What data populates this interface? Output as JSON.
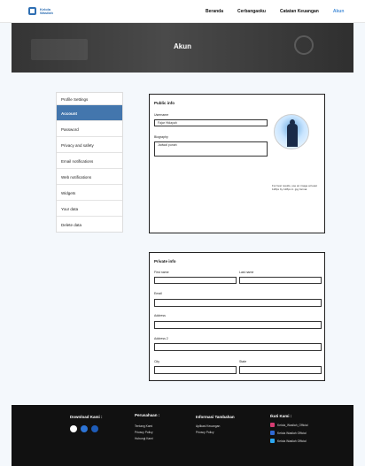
{
  "brand": {
    "line1": "Kelola",
    "line2": "Wasilah"
  },
  "nav": {
    "items": [
      "Beranda",
      "Cerbangaoku",
      "Catatan Keuangan",
      "Akun"
    ]
  },
  "hero": {
    "title": "Akun"
  },
  "sidebar": {
    "heading": "Profile Settings",
    "items": [
      "Account",
      "Password",
      "Privacy and safety",
      "Email notifications",
      "Web notifications",
      "Widgets",
      "Your data",
      "Delete data"
    ]
  },
  "public": {
    "title": "Public info",
    "username_label": "Username",
    "username_value": "Fajar Hidayah",
    "biography_label": "Biography",
    "biography_value": "Jadwal punah",
    "photo_note": "For best results, use an image at least 128px by 128px in .jpg format"
  },
  "private": {
    "title": "Private info",
    "first_name": "First name",
    "last_name": "Last name",
    "email": "Email",
    "address": "Address",
    "address2": "Address 2",
    "city": "City",
    "state": "State"
  },
  "footer": {
    "col1_title": "Download Kami :",
    "col2_title": "Perusahaan :",
    "col2_items": [
      "Tentang Kami",
      "Privacy Policy",
      "Hubungi Kami"
    ],
    "col3_title": "Informasi Tambahan",
    "col3_items": [
      "Aplikasi Keuangan",
      "Privacy Policy"
    ],
    "col4_title": "Ikuti Kami :",
    "col4_items": [
      "Kelola_Wasilah_Official",
      "Kelola Wasilah Official",
      "Kelola Wasilah Official"
    ]
  }
}
